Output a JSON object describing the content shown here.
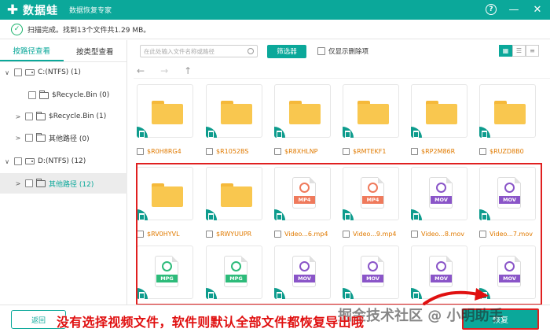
{
  "app": {
    "name": "数据蛙",
    "subtitle": "数据恢复专家"
  },
  "window_controls": {
    "help": "?",
    "minimize": "—",
    "close": "✕"
  },
  "scan": {
    "status": "扫描完成。找到13个文件共1.29 MB。"
  },
  "left_tabs": [
    {
      "label": "按路径查看",
      "active": true
    },
    {
      "label": "按类型查看",
      "active": false
    }
  ],
  "tree": [
    {
      "label": "C:(NTFS) (1)",
      "type": "drive",
      "expander": "∨"
    },
    {
      "label": "$Recycle.Bin (0)",
      "type": "folder",
      "expander": ""
    },
    {
      "label": "$Recycle.Bin (1)",
      "type": "folder",
      "expander": ">"
    },
    {
      "label": "其他路径 (0)",
      "type": "folder",
      "expander": ">"
    },
    {
      "label": "D:(NTFS) (12)",
      "type": "drive",
      "expander": "∨"
    },
    {
      "label": "其他路径 (12)",
      "type": "folder",
      "expander": ">",
      "selected": true
    }
  ],
  "toolbar": {
    "search_placeholder": "在此处输入文件名称或路径",
    "filter_label": "筛选器",
    "only_deleted_label": "仅显示删除项"
  },
  "nav": {
    "back": "←",
    "forward": "→",
    "up": "↑"
  },
  "files": [
    {
      "name": "$R0H8RG4",
      "kind": "folder"
    },
    {
      "name": "$R1052BS",
      "kind": "folder"
    },
    {
      "name": "$R8XHLNP",
      "kind": "folder"
    },
    {
      "name": "$RMTEKF1",
      "kind": "folder"
    },
    {
      "name": "$RP2M86R",
      "kind": "folder"
    },
    {
      "name": "$RUZD8B0",
      "kind": "folder"
    },
    {
      "name": "$RV0HYVL",
      "kind": "folder"
    },
    {
      "name": "$RWYUUPR",
      "kind": "folder"
    },
    {
      "name": "Video...6.mp4",
      "kind": "MP4"
    },
    {
      "name": "Video...9.mp4",
      "kind": "MP4"
    },
    {
      "name": "Video...8.mov",
      "kind": "MOV"
    },
    {
      "name": "Video...7.mov",
      "kind": "MOV"
    },
    {
      "name": "",
      "kind": "MPG"
    },
    {
      "name": "",
      "kind": "MPG"
    },
    {
      "name": "",
      "kind": "MOV"
    },
    {
      "name": "",
      "kind": "MOV"
    },
    {
      "name": "",
      "kind": "MOV"
    },
    {
      "name": "",
      "kind": "MOV"
    }
  ],
  "colors": {
    "accent": "#0ba89a",
    "mp4": "#ef7a5c",
    "mov": "#8a55c8",
    "mpg": "#2dbb7a",
    "folder": "#f9c74f",
    "highlight": "#e02020"
  },
  "bottom": {
    "back_label": "返回",
    "recover_label": "恢复"
  },
  "annotation": {
    "caption": "没有选择视频文件，软件则默认全部文件都恢复导出哦",
    "watermark": "掘金技术社区 @ 小明助手"
  }
}
